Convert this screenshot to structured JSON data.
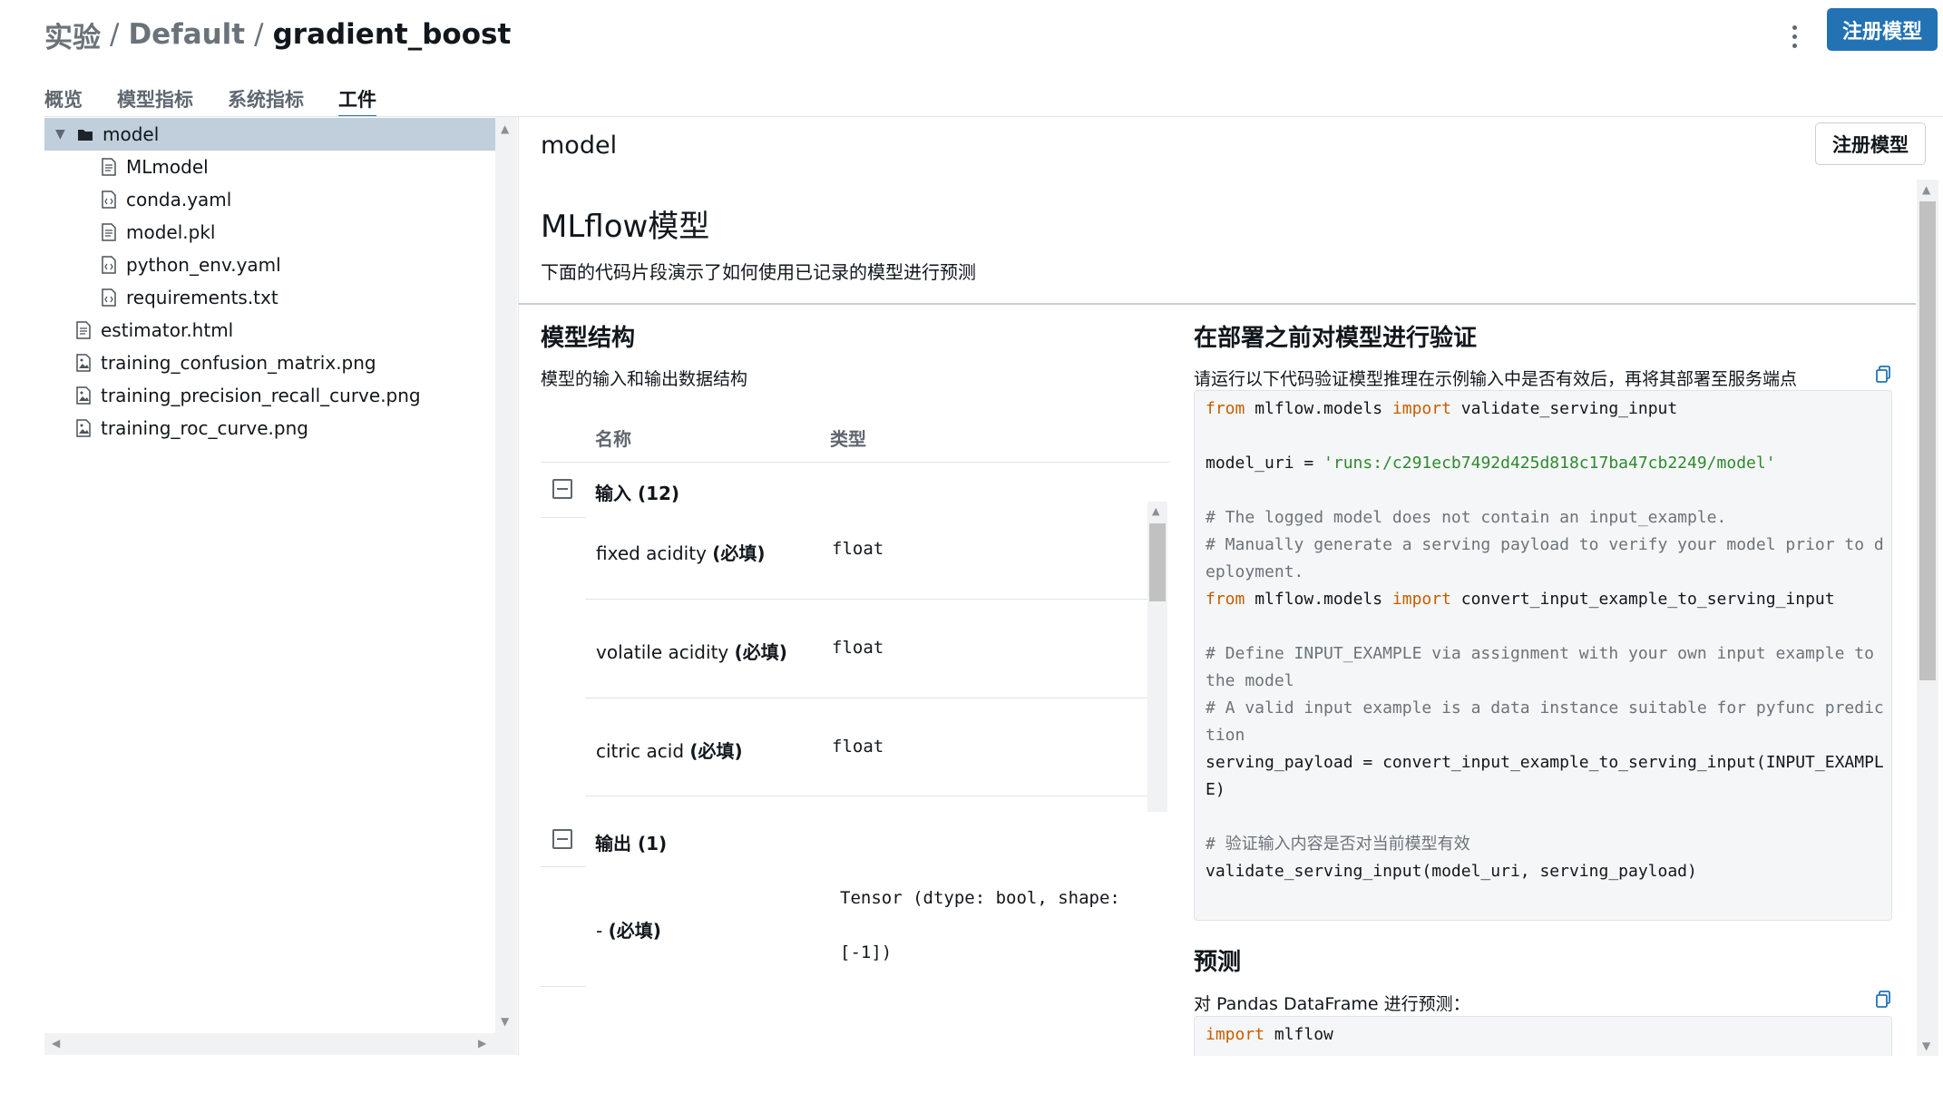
{
  "header": {
    "breadcrumb": [
      "实验",
      "Default"
    ],
    "separator": "/",
    "current": "gradient_boost",
    "register_button": "注册模型"
  },
  "tabs": [
    {
      "label": "概览",
      "active": false
    },
    {
      "label": "模型指标",
      "active": false
    },
    {
      "label": "系统指标",
      "active": false
    },
    {
      "label": "工件",
      "active": true
    }
  ],
  "tree": {
    "items": [
      {
        "label": "model",
        "icon": "folder-icon",
        "expanded": true,
        "selected": true
      },
      {
        "label": "MLmodel",
        "icon": "file-text-icon"
      },
      {
        "label": "conda.yaml",
        "icon": "file-code-icon"
      },
      {
        "label": "model.pkl",
        "icon": "file-text-icon"
      },
      {
        "label": "python_env.yaml",
        "icon": "file-code-icon"
      },
      {
        "label": "requirements.txt",
        "icon": "file-code-icon"
      },
      {
        "label": "estimator.html",
        "icon": "file-text-icon"
      },
      {
        "label": "training_confusion_matrix.png",
        "icon": "file-image-icon"
      },
      {
        "label": "training_precision_recall_curve.png",
        "icon": "file-image-icon"
      },
      {
        "label": "training_roc_curve.png",
        "icon": "file-image-icon"
      }
    ]
  },
  "main": {
    "title": "model",
    "register_button": "注册模型",
    "heading": "MLflow模型",
    "subtitle": "下面的代码片段演示了如何使用已记录的模型进行预测",
    "schema": {
      "title": "模型结构",
      "subtitle": "模型的输入和输出数据结构",
      "col_name": "名称",
      "col_type": "类型",
      "inputs_label": "输入 (12)",
      "inputs": [
        {
          "name": "fixed acidity",
          "required": "(必填)",
          "type": "float"
        },
        {
          "name": "volatile acidity",
          "required": "(必填)",
          "type": "float"
        },
        {
          "name": "citric acid",
          "required": "(必填)",
          "type": "float"
        }
      ],
      "outputs_label": "输出 (1)",
      "outputs": [
        {
          "name": "-",
          "required": "(必填)",
          "type": "Tensor (dtype: bool, shape:\n[-1])"
        }
      ]
    },
    "validate": {
      "title": "在部署之前对模型进行验证",
      "subtitle": "请运行以下代码验证模型推理在示例输入中是否有效后，再将其部署至服务端点",
      "code": {
        "l1_kw1": "from",
        "l1_mid": " mlflow.models ",
        "l1_kw2": "import",
        "l1_rest": " validate_serving_input",
        "l3_a": "model_uri = ",
        "l3_str": "'runs:/c291ecb7492d425d818c17ba47cb2249/model'",
        "c1": "# The logged model does not contain an input_example.",
        "c2a": "# Manually generate a serving payload to verify your model prior to d",
        "c2b": "eployment.",
        "l7_kw1": "from",
        "l7_mid": " mlflow.models ",
        "l7_kw2": "import",
        "l7_rest": " convert_input_example_to_serving_input",
        "c3a": "# Define INPUT_EXAMPLE via assignment with your own input example to",
        "c3b": "the model",
        "c4a": "# A valid input example is a data instance suitable for pyfunc predic",
        "c4b": "tion",
        "l14a": "serving_payload = convert_input_example_to_serving_input(INPUT_EXAMPL",
        "l14b": "E)",
        "c5": "# 验证输入内容是否对当前模型有效",
        "l17": "validate_serving_input(model_uri, serving_payload)"
      }
    },
    "predict": {
      "title": "预测",
      "subtitle": "对 Pandas DataFrame 进行预测：",
      "code_kw": "import",
      "code_rest": " mlflow"
    }
  },
  "colors": {
    "accent": "#2272b4",
    "selected_row": "#c1cfdc",
    "keyword": "#c65e00",
    "string": "#2d8a2d"
  }
}
